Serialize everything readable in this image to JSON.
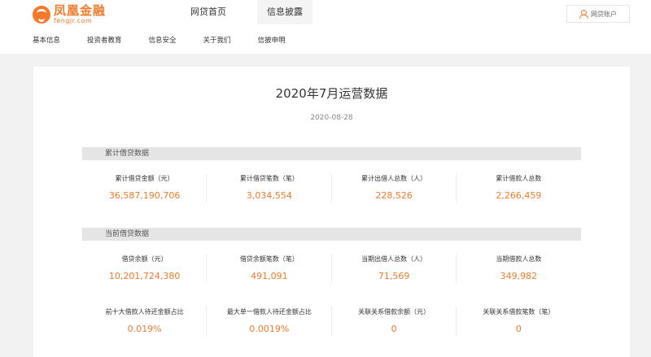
{
  "brand": {
    "name_cn": "凤凰金融",
    "name_en": "fengjr.com",
    "color": "#f47a2a"
  },
  "main_nav": [
    {
      "label": "网贷首页",
      "active": false
    },
    {
      "label": "信息披露",
      "active": true
    }
  ],
  "account": {
    "label": "网贷账户",
    "icon": "user-icon"
  },
  "sub_nav": [
    {
      "label": "基本信息"
    },
    {
      "label": "投资者教育"
    },
    {
      "label": "信息安全"
    },
    {
      "label": "关于我们"
    },
    {
      "label": "信披申明"
    }
  ],
  "report": {
    "title": "2020年7月运营数据",
    "date": "2020-08-28"
  },
  "sections": [
    {
      "title": "累计借贷数据",
      "rows": [
        [
          {
            "label": "累计借贷金额（元）",
            "value": "36,587,190,706"
          },
          {
            "label": "累计借贷笔数（笔）",
            "value": "3,034,554"
          },
          {
            "label": "累计出借人总数（人）",
            "value": "228,526"
          },
          {
            "label": "累计借款人总数",
            "value": "2,266,459"
          }
        ]
      ]
    },
    {
      "title": "当前借贷数据",
      "rows": [
        [
          {
            "label": "借贷余额（元）",
            "value": "10,201,724,380"
          },
          {
            "label": "借贷余额笔数（笔）",
            "value": "491,091"
          },
          {
            "label": "当期出借人总数（人）",
            "value": "71,569"
          },
          {
            "label": "当期借款人总数",
            "value": "349,982"
          }
        ],
        [
          {
            "label": "前十大借款人待还金额占比",
            "value": "0.019%"
          },
          {
            "label": "最大单一借款人待还金额占比",
            "value": "0.0019%"
          },
          {
            "label": "关联关系借款余额（元）",
            "value": "0"
          },
          {
            "label": "关联关系借款笔数（笔）",
            "value": "0"
          }
        ]
      ]
    }
  ]
}
